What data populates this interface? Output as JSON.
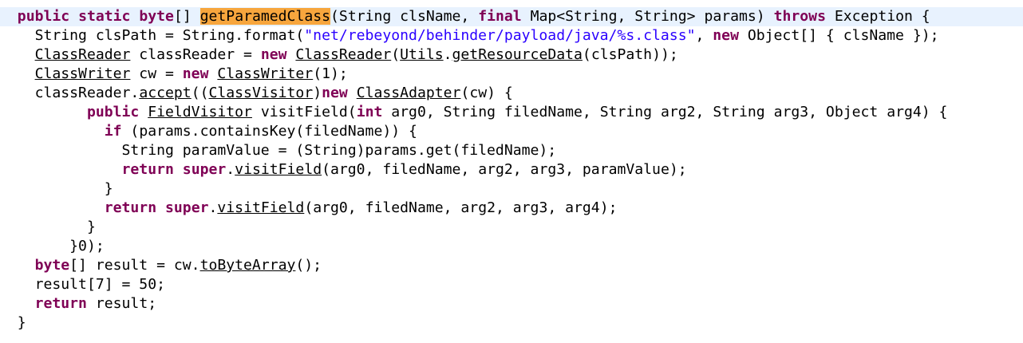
{
  "code": {
    "line1": {
      "kw_public": "public",
      "kw_static": "static",
      "kw_byte": "byte",
      "t_brackets": "[] ",
      "method": "getParamedClass",
      "t_params": "(String clsName, ",
      "kw_final": "final",
      "t_map": " Map<String, String> params) ",
      "kw_throws": "throws",
      "t_exc": " Exception {"
    },
    "line2": {
      "t_a": "String clsPath = String.format(",
      "str": "\"net/rebeyond/behinder/payload/java/%s.class\"",
      "t_b": ", ",
      "kw_new": "new",
      "t_c": " Object[] { clsName });"
    },
    "line3": {
      "cls": "ClassReader",
      "t_a": " classReader = ",
      "kw_new": "new",
      "ctor": "ClassReader",
      "t_b": "(",
      "utils": "Utils",
      "t_c": ".",
      "getres": "getResourceData",
      "t_d": "(clsPath));"
    },
    "line4": {
      "cls": "ClassWriter",
      "t_a": " cw = ",
      "kw_new": "new",
      "ctor": "ClassWriter",
      "t_b": "(1);"
    },
    "line5": {
      "t_a": "classReader.",
      "accept": "accept",
      "t_b": "((",
      "visitor": "ClassVisitor",
      "t_c": ")",
      "kw_new": "new",
      "adapter": "ClassAdapter",
      "t_d": "(cw) {"
    },
    "line6": {
      "kw_public": "public",
      "fv": "FieldVisitor",
      "t_a": " visitField(",
      "kw_int": "int",
      "t_b": " arg0, String filedName, String arg2, String arg3, Object arg4) {"
    },
    "line7": {
      "kw_if": "if",
      "t_a": " (params.containsKey(filedName)) {"
    },
    "line8": {
      "t_a": "String paramValue = (String)params.get(filedName);"
    },
    "line9": {
      "kw_return": "return",
      "kw_super": "super",
      "t_a": ".",
      "vf": "visitField",
      "t_b": "(arg0, filedName, arg2, arg3, paramValue);"
    },
    "line10": {
      "t_a": "}"
    },
    "line11": {
      "kw_return": "return",
      "kw_super": "super",
      "t_a": ".",
      "vf": "visitField",
      "t_b": "(arg0, filedName, arg2, arg3, arg4);"
    },
    "line12": {
      "t_a": "}"
    },
    "line13": {
      "t_a": "}0);"
    },
    "line14": {
      "kw_byte": "byte",
      "t_a": "[] result = cw.",
      "tba": "toByteArray",
      "t_b": "();"
    },
    "line15": {
      "t_a": "result[7] = 50;"
    },
    "line16": {
      "kw_return": "return",
      "t_a": " result;"
    },
    "line17": {
      "t_a": "}"
    }
  },
  "colors": {
    "keyword": "#7f0055",
    "string": "#2a00ff",
    "highlight": "#f7a63d",
    "current_line": "#e8f2fe"
  }
}
